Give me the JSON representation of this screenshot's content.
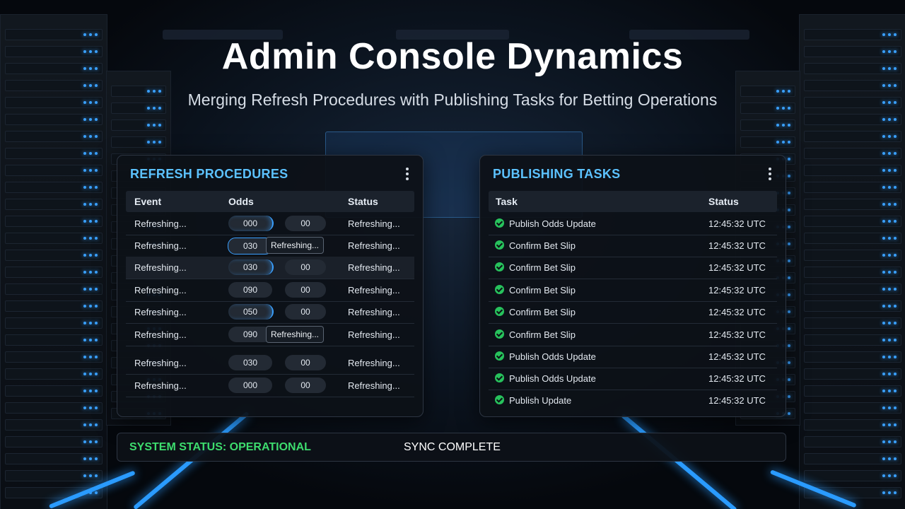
{
  "header": {
    "title": "Admin Console Dynamics",
    "subtitle": "Merging Refresh Procedures with Publishing Tasks for Betting Operations"
  },
  "refresh_panel": {
    "title": "REFRESH PROCEDURES",
    "columns": [
      "Event",
      "Odds",
      "Status"
    ],
    "rows": [
      {
        "event": "Refreshing...",
        "odds": "000",
        "value": "00",
        "status": "Refreshing..."
      },
      {
        "event": "Refreshing...",
        "odds": "030",
        "tooltip": "Refreshing...",
        "status": "Refreshing..."
      },
      {
        "event": "Refreshing...",
        "odds": "030",
        "value": "00",
        "status": "Refreshing..."
      },
      {
        "event": "Refreshing...",
        "odds": "090",
        "value": "00",
        "status": "Refreshing..."
      },
      {
        "event": "Refreshing...",
        "odds": "050",
        "value": "00",
        "status": "Refreshing..."
      },
      {
        "event": "Refreshing...",
        "odds": "090",
        "tooltip": "Refreshing...",
        "status": "Refreshing..."
      },
      {
        "event": "Refreshing...",
        "odds": "030",
        "value": "00",
        "status": "Refreshing..."
      },
      {
        "event": "Refreshing...",
        "odds": "000",
        "value": "00",
        "status": "Refreshing..."
      }
    ]
  },
  "publish_panel": {
    "title": "PUBLISHING TASKS",
    "columns": [
      "Task",
      "Status"
    ],
    "rows": [
      {
        "task": "Publish Odds Update",
        "status": "12:45:32 UTC"
      },
      {
        "task": "Confirm Bet Slip",
        "status": "12:45:32 UTC"
      },
      {
        "task": "Confirm Bet Slip",
        "status": "12:45:32 UTC"
      },
      {
        "task": "Confirm Bet Slip",
        "status": "12:45:32 UTC"
      },
      {
        "task": "Confirm Bet Slip",
        "status": "12:45:32 UTC"
      },
      {
        "task": "Confirm Bet Slip",
        "status": "12:45:32 UTC"
      },
      {
        "task": "Publish Odds Update",
        "status": "12:45:32 UTC"
      },
      {
        "task": "Publish Odds Update",
        "status": "12:45:32 UTC"
      },
      {
        "task": "Publish Update",
        "status": "12:45:32 UTC"
      }
    ]
  },
  "statusbar": {
    "system": "SYSTEM STATUS: OPERATIONAL",
    "sync": "SYNC COMPLETE"
  },
  "colors": {
    "accent": "#5cc2ff",
    "success": "#27c25c",
    "operational": "#3ddc6e"
  },
  "icons": {
    "check": "check-circle-icon",
    "menu": "more-vertical-icon"
  }
}
